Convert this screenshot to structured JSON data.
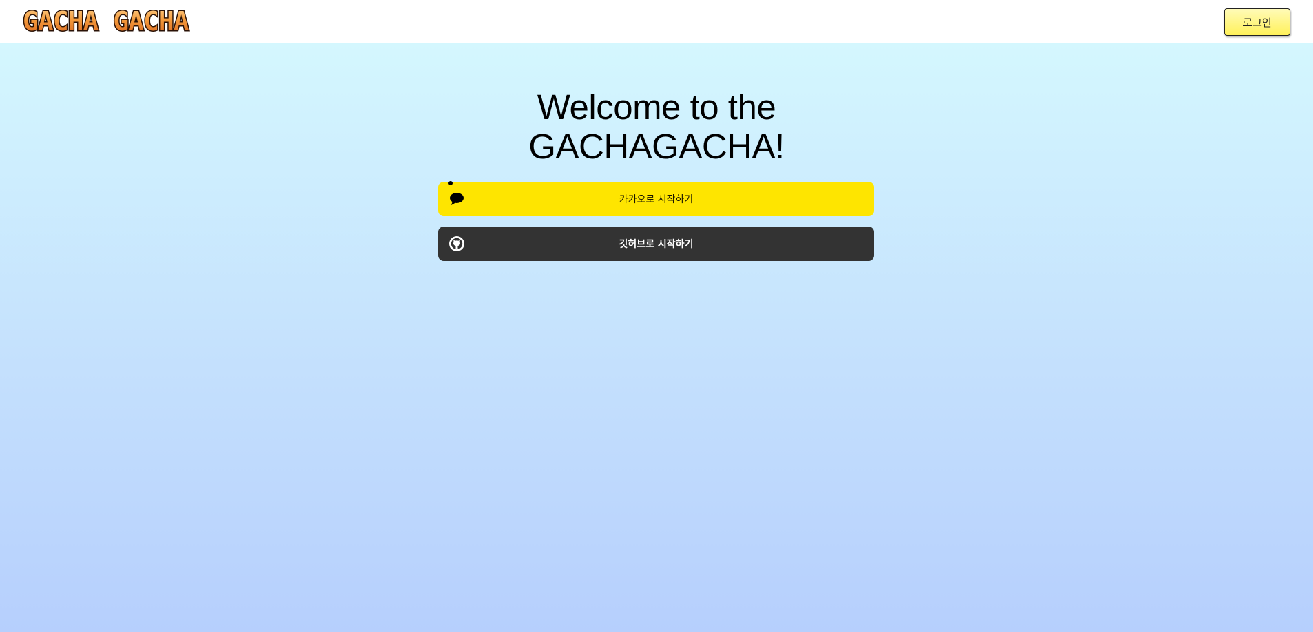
{
  "header": {
    "logo_text": "GACHA GACHA",
    "login_label": "로그인"
  },
  "main": {
    "title_line1": "Welcome to the",
    "title_line2": "GACHAGACHA!",
    "kakao": {
      "label": "카카오로 시작하기",
      "icon": "speech-bubble-icon",
      "color": "#fee500"
    },
    "github": {
      "label": "깃허브로 시작하기",
      "icon": "github-icon",
      "color": "#333333"
    }
  },
  "colors": {
    "background_top": "#d4f7fe",
    "background_bottom": "#b6cffd",
    "login_button": "#fff15a"
  }
}
